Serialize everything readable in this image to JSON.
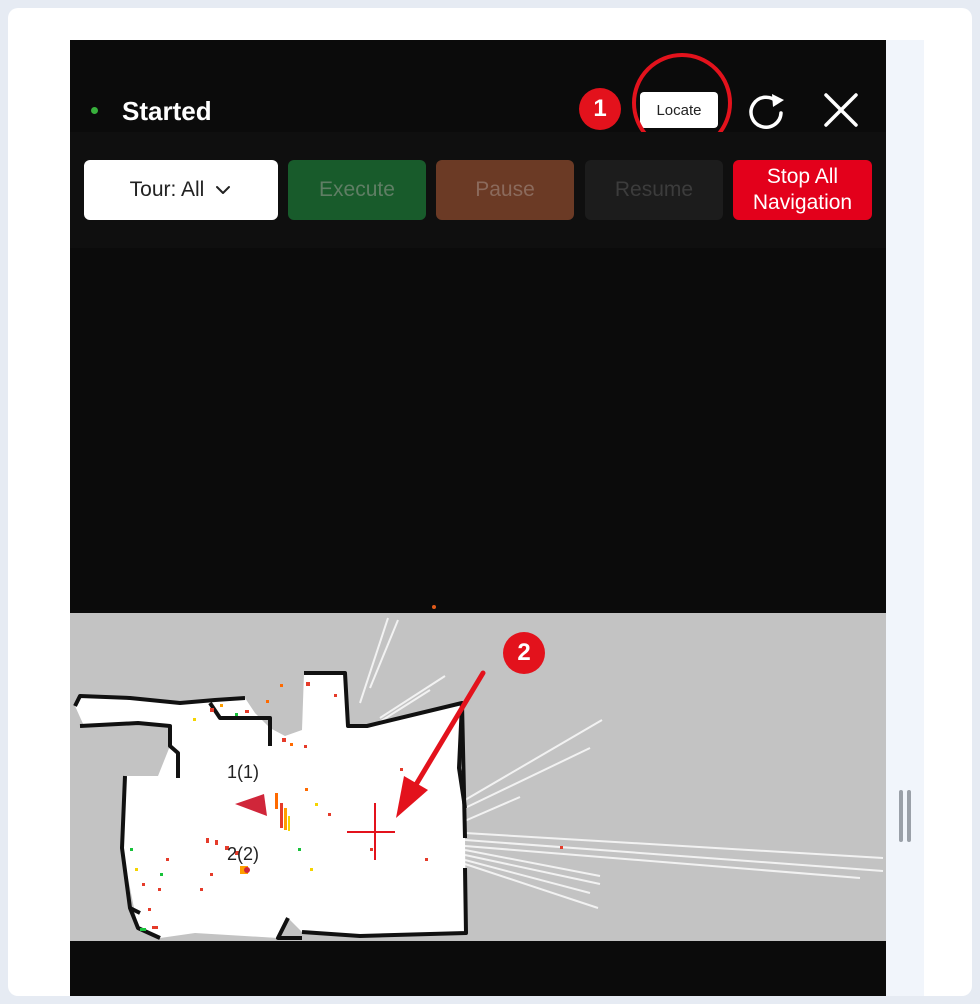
{
  "header": {
    "status_label": "Started",
    "status_color": "#38b03c",
    "locate_label": "Locate",
    "refresh_icon": "refresh-icon",
    "close_icon": "close-icon"
  },
  "toolbar": {
    "tour_label": "Tour: All",
    "execute_label": "Execute",
    "pause_label": "Pause",
    "resume_label": "Resume",
    "stop_line1": "Stop All",
    "stop_line2": "Navigation"
  },
  "annotations": {
    "step1": "1",
    "step2": "2",
    "accent": "#e3121c"
  },
  "map": {
    "waypoint1_label": "1(1)",
    "waypoint2_label": "2(2)"
  }
}
